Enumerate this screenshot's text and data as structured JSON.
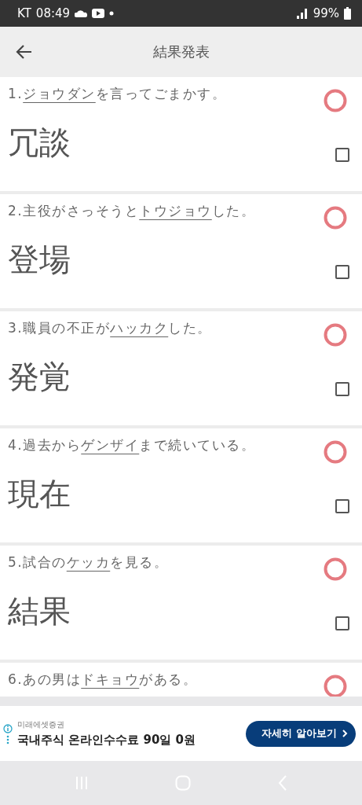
{
  "status_bar": {
    "carrier": "KT",
    "time": "08:49",
    "battery": "99%"
  },
  "app_bar": {
    "title": "結果発表"
  },
  "questions": [
    {
      "number": "1.",
      "answer_kana": "ジョウダン",
      "after": "を言ってごまかす。",
      "correct": true,
      "word": "冗談",
      "checked": false
    },
    {
      "number": "2.",
      "before": "主役がさっそうと",
      "answer_kana": "トウジョウ",
      "after": "した。",
      "correct": true,
      "word": "登場",
      "checked": false
    },
    {
      "number": "3.",
      "before": "職員の不正が",
      "answer_kana": "ハッカク",
      "after": "した。",
      "correct": true,
      "word": "発覚",
      "checked": false
    },
    {
      "number": "4.",
      "before": "過去から",
      "answer_kana": "ゲンザイ",
      "after": "まで続いている。",
      "correct": true,
      "word": "現在",
      "checked": false
    },
    {
      "number": "5.",
      "before": "試合の",
      "answer_kana": "ケッカ",
      "after": "を見る。",
      "correct": true,
      "word": "結果",
      "checked": false
    },
    {
      "number": "6.",
      "before": "あの男は",
      "answer_kana": "ドキョウ",
      "after": "がある。",
      "correct": true
    }
  ],
  "ad": {
    "advertiser": "미래에셋증권",
    "headline": "국내주식 온라인수수료 90일 0원",
    "button": "자세히 알아보기"
  }
}
